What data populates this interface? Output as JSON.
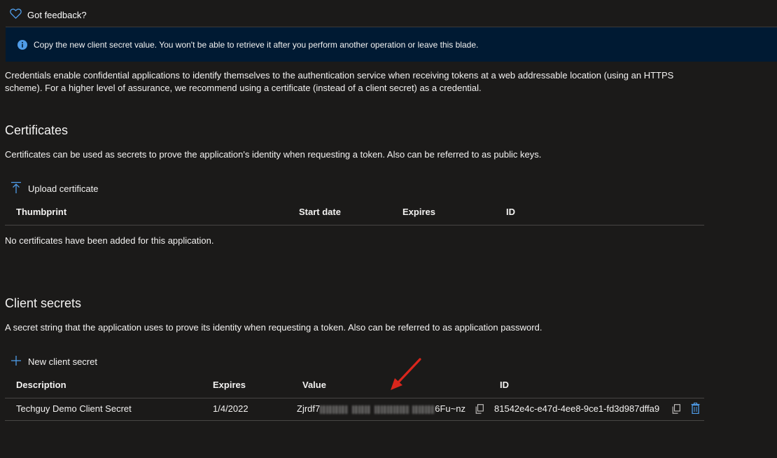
{
  "feedback": {
    "label": "Got feedback?",
    "icon": "heart-icon"
  },
  "banner": {
    "icon": "info-icon",
    "text": "Copy the new client secret value. You won't be able to retrieve it after you perform another operation or leave this blade."
  },
  "intro": {
    "line1": "Credentials enable confidential applications to identify themselves to the authentication service when receiving tokens at a web addressable location (using an HTTPS",
    "line2": "scheme). For a higher level of assurance, we recommend using a certificate (instead of a client secret) as a credential."
  },
  "certificates": {
    "title": "Certificates",
    "description": "Certificates can be used as secrets to prove the application's identity when requesting a token. Also can be referred to as public keys.",
    "upload_label": "Upload certificate",
    "columns": [
      "Thumbprint",
      "Start date",
      "Expires",
      "ID"
    ],
    "empty_text": "No certificates have been added for this application."
  },
  "client_secrets": {
    "title": "Client secrets",
    "description": "A secret string that the application uses to prove its identity when requesting a token. Also can be referred to as application password.",
    "new_label": "New client secret",
    "columns": [
      "Description",
      "Expires",
      "Value",
      "ID"
    ],
    "rows": [
      {
        "description": "Techguy Demo Client Secret",
        "expires": "1/4/2022",
        "value_start": "Zjrdf7",
        "value_end": "6Fu~nz",
        "id": "81542e4c-e47d-4ee8-9ce1-fd3d987dffa9"
      }
    ]
  },
  "colors": {
    "accent": "#4f9ce8",
    "banner_bg": "#001a33",
    "page_bg": "#1b1a19",
    "arrow": "#d9261c"
  }
}
